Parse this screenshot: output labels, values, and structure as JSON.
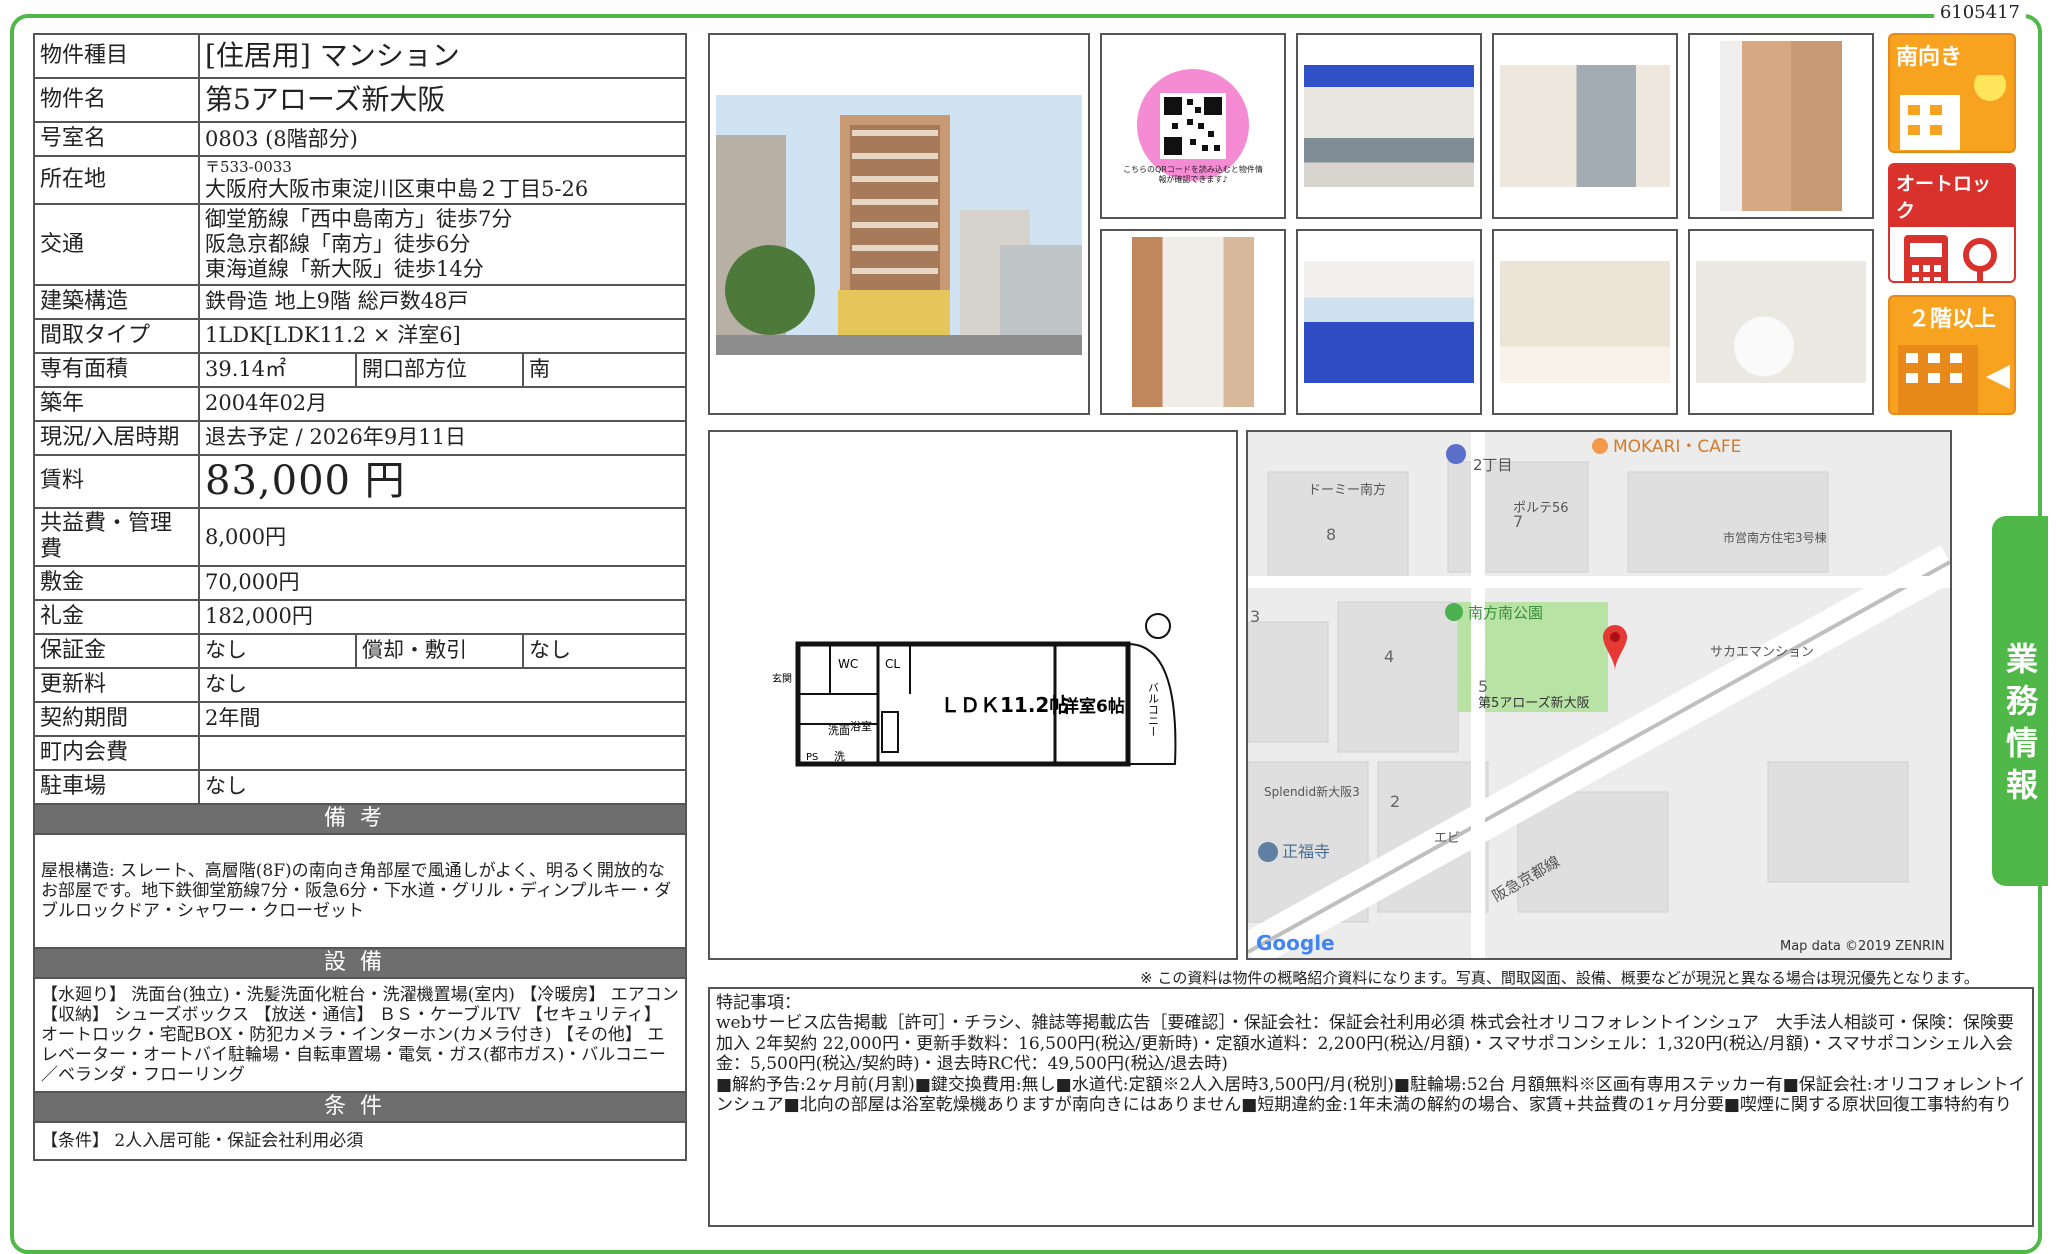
{
  "doc_id": "6105417",
  "spec": {
    "type_label": "物件種目",
    "type_value": "[住居用] マンション",
    "name_label": "物件名",
    "name_value": "第5アローズ新大阪",
    "room_label": "号室名",
    "room_value": "0803 (8階部分)",
    "address_label": "所在地",
    "postal": "〒533-0033",
    "address_value": "大阪府大阪市東淀川区東中島２丁目5-26",
    "access_label": "交通",
    "access": [
      "御堂筋線「西中島南方」徒歩7分",
      "阪急京都線「南方」徒歩6分",
      "東海道線「新大阪」徒歩14分"
    ],
    "structure_label": "建築構造",
    "structure_value": "鉄骨造 地上9階 総戸数48戸",
    "layout_label": "間取タイプ",
    "layout_value": "1LDK[LDK11.2 × 洋室6]",
    "area_label": "専有面積",
    "area_value": "39.14㎡",
    "opening_label": "開口部方位",
    "opening_value": "南",
    "built_label": "築年",
    "built_value": "2004年02月",
    "status_label": "現況/入居時期",
    "status_value": "退去予定 / 2026年9月11日",
    "rent_label": "賃料",
    "rent_value": "83,000 円",
    "fee_label": "共益費・管理費",
    "fee_value": "8,000円",
    "deposit_label": "敷金",
    "deposit_value": "70,000円",
    "keymoney_label": "礼金",
    "keymoney_value": "182,000円",
    "guarantee_label": "保証金",
    "guarantee_value": "なし",
    "amort_label": "償却・敷引",
    "amort_value": "なし",
    "renewal_label": "更新料",
    "renewal_value": "なし",
    "contract_label": "契約期間",
    "contract_value": "2年間",
    "town_label": "町内会費",
    "town_value": "",
    "parking_label": "駐車場",
    "parking_value": "なし",
    "remarks_head": "備考",
    "remarks_text": "屋根構造: スレート、高層階(8F)の南向き角部屋で風通しがよく、明るく開放的なお部屋です。地下鉄御堂筋線7分・阪急6分・下水道・グリル・ディンプルキー・ダブルロックドア・シャワー・クローゼット",
    "equip_head": "設備",
    "equip_text": "【水廻り】 洗面台(独立)・洗髪洗面化粧台・洗濯機置場(室内) 【冷暖房】 エアコン 【収納】 シューズボックス 【放送・通信】 ＢＳ・ケーブルTV 【セキュリティ】 オートロック・宅配BOX・防犯カメラ・インターホン(カメラ付き) 【その他】 エレベーター・オートバイ駐輪場・自転車置場・電気・ガス(都市ガス)・バルコニー／ベランダ・フローリング",
    "cond_head": "条件",
    "cond_text": "【条件】 2人入居可能・保証会社利用必須"
  },
  "qr_caption": "こちらのQRコードを読み込むと物件情報が確認できます♪",
  "icons": {
    "south": "南向き",
    "autolock": "オートロック",
    "floor2": "２階以上"
  },
  "floorplan": {
    "ldk": "ＬＤＫ11.2帖",
    "western": "洋室6帖",
    "wc": "WC",
    "cl": "CL",
    "washroom": "洗面",
    "bath": "浴室",
    "ps": "PS",
    "wash": "洗",
    "balcony": "バルコニー",
    "genkan": "玄関"
  },
  "map": {
    "labels": [
      "2丁目",
      "MOKARI・CAFE",
      "ドーミー南方",
      "ポルテ56",
      "市営南方住宅3号棟",
      "南方南公園",
      "サカエマンション",
      "第5アローズ新大阪",
      "Splendid新大阪3",
      "正福寺",
      "エビ",
      "阪急京都線"
    ],
    "blocks": [
      "8",
      "7",
      "3",
      "4",
      "5",
      "2"
    ],
    "google": "Google",
    "credit": "Map data ©2019 ZENRIN"
  },
  "notice": "※ この資料は物件の概略紹介資料になります。写真、間取図面、設備、概要などが現況と異なる場合は現況優先となります。",
  "special": {
    "head": "特記事項：",
    "lines": [
      "webサービス広告掲載［許可］・チラシ、雑誌等掲載広告［要確認］・保証会社：保証会社利用必須 株式会社オリコフォレントインシュア　大手法人相談可・保険：保険要加入 2年契約 22,000円・更新手数料：16,500円(税込/更新時)・定額水道料：2,200円(税込/月額)・スマサポコンシェル：1,320円(税込/月額)・スマサポコンシェル入会金：5,500円(税込/契約時)・退去時RC代：49,500円(税込/退去時)",
      "■解約予告:2ヶ月前(月割)■鍵交換費用:無し■水道代:定額※2人入居時3,500円/月(税別)■駐輪場:52台 月額無料※区画有専用ステッカー有■保証会社:オリコフォレントインシュア■北向の部屋は浴室乾燥機ありますが南向きにはありません■短期違約金:1年未満の解約の場合、家賃+共益費の1ヶ月分要■喫煙に関する原状回復工事特約有り"
    ]
  },
  "side_tab": "業務情報"
}
